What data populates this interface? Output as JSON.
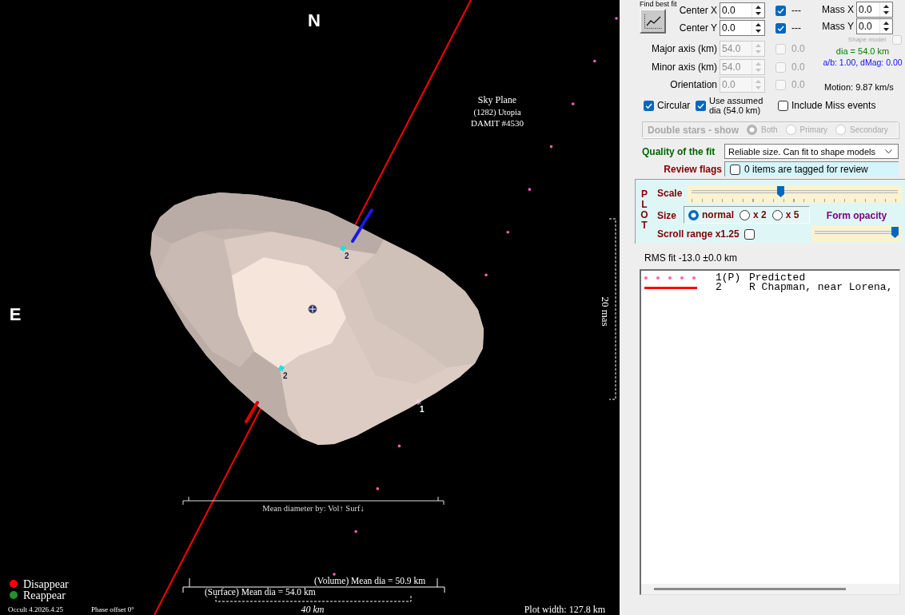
{
  "plot": {
    "north_label": "N",
    "east_label": "E",
    "view_title": "Sky Plane",
    "object_name": "(1282) Utopia",
    "shape_model_id": "DAMIT #4530",
    "angular_scale": "20 mas",
    "markers": [
      {
        "kind": "event",
        "label": "2"
      },
      {
        "kind": "event",
        "label": "2"
      },
      {
        "kind": "star",
        "label": "1"
      }
    ],
    "mean_diameter_caption": "Mean diameter by: Vol↑ Surf↓",
    "volume_diameter": "(Volume) Mean dia = 50.9 km",
    "surface_diameter": "(Surface) Mean dia = 54.0 km",
    "distance_scale": "40 km",
    "legend": [
      {
        "label": "Disappear",
        "color": "#ff0000"
      },
      {
        "label": "Reappear",
        "color": "#22922a"
      }
    ],
    "version": "Occult 4.2026.4.25",
    "phase_offset": "Phase offset 0°",
    "plot_width": "Plot width: 127.8 km"
  },
  "fit_panel": {
    "title": "Find best fit",
    "fit_fields": [
      {
        "label": "Center X",
        "value": "0.0",
        "checked": true,
        "reading": "---",
        "disabled": false
      },
      {
        "label": "Center Y",
        "value": "0.0",
        "checked": true,
        "reading": "---",
        "disabled": false
      },
      {
        "label": "Major axis (km)",
        "value": "54.0",
        "checked": false,
        "reading": "0.0",
        "disabled": true
      },
      {
        "label": "Minor axis (km)",
        "value": "54.0",
        "checked": false,
        "reading": "0.0",
        "disabled": true
      },
      {
        "label": "Orientation",
        "value": "0.0",
        "checked": false,
        "reading": "0.0",
        "disabled": true
      }
    ],
    "mass_fields": [
      {
        "label": "Mass X",
        "value": "0.0"
      },
      {
        "label": "Mass Y",
        "value": "0.0"
      }
    ],
    "shape_model": {
      "label": "Shape model",
      "checked": false,
      "disabled": true
    },
    "diameter": "dia = 54.0 km",
    "ratio": "a/b: 1.00, dMag: 0.00",
    "motion": "Motion: 9.87 km/s",
    "options": [
      {
        "label": "Circular",
        "checked": true
      },
      {
        "label": "Use assumed dia (54.0 km)",
        "checked": true
      },
      {
        "label": "Include Miss events",
        "checked": false
      }
    ]
  },
  "double_stars": {
    "label": "Double stars - show",
    "disabled": true,
    "options": [
      {
        "label": "Both",
        "selected": true
      },
      {
        "label": "Primary",
        "selected": false
      },
      {
        "label": "Secondary",
        "selected": false
      }
    ]
  },
  "fit_quality": {
    "label": "Quality of the fit",
    "value": "Reliable size. Can fit to shape models"
  },
  "review_flags": {
    "label": "Review flags",
    "checked": false,
    "text": "0 items are tagged for review"
  },
  "plot_settings": {
    "title": "PLOT",
    "scale": {
      "label": "Scale",
      "level": 0.43
    },
    "size": {
      "label": "Size",
      "options": [
        {
          "label": "normal",
          "selected": true
        },
        {
          "label": "x 2",
          "selected": false
        },
        {
          "label": "x 5",
          "selected": false
        }
      ]
    },
    "form_opacity": {
      "label": "Form opacity",
      "level": 1
    },
    "scroll_range": {
      "label": "Scroll range x1.25",
      "checked": false
    }
  },
  "rms_fit": "RMS fit -13.0 ±0.0 km",
  "chords": [
    {
      "kind": "dotted",
      "color": "#ff5fb4",
      "number": "1(P)",
      "observer": "Predicted"
    },
    {
      "kind": "solid",
      "color": "#ff0000",
      "number": "2",
      "observer": "R Chapman, near Lorena,"
    }
  ]
}
